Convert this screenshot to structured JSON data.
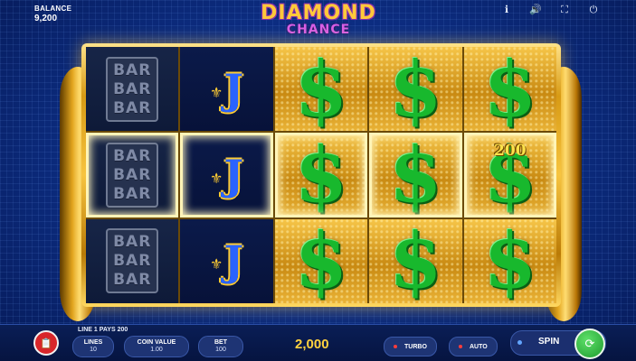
{
  "header": {
    "balance_label": "BALANCE",
    "balance_value": "9,200",
    "logo_line1": "DIAMOND",
    "logo_line2": "CHANCE",
    "icons": [
      "info-icon",
      "sound-icon",
      "fullscreen-icon",
      "power-icon"
    ]
  },
  "reels": {
    "columns": [
      [
        "bar",
        "bar",
        "bar"
      ],
      [
        "jack",
        "jack",
        "jack"
      ],
      [
        "dollar",
        "dollar",
        "dollar"
      ],
      [
        "dollar",
        "dollar",
        "dollar"
      ],
      [
        "dollar",
        "dollar",
        "dollar"
      ]
    ],
    "bar_text": "BAR",
    "jack_letter": "J",
    "dollar_symbol": "$",
    "win_amount": "200",
    "win_line_row": 2
  },
  "footer": {
    "line_pays": "LINE 1 PAYS 200",
    "lines_label": "LINES",
    "lines_value": "10",
    "coin_value_label": "COIN VALUE",
    "coin_value_value": "1.00",
    "bet_label": "BET",
    "bet_value": "100",
    "win_total": "2,000",
    "turbo_label": "TURBO",
    "auto_label": "AUTO",
    "spin_label": "SPIN"
  },
  "colors": {
    "background": "#0d2f86",
    "gold": "#f7c440",
    "dollar_green": "#18b82d",
    "jack_blue": "#2a63ff",
    "win_text": "#ffd23f",
    "spin_green": "#1e9b2d"
  }
}
